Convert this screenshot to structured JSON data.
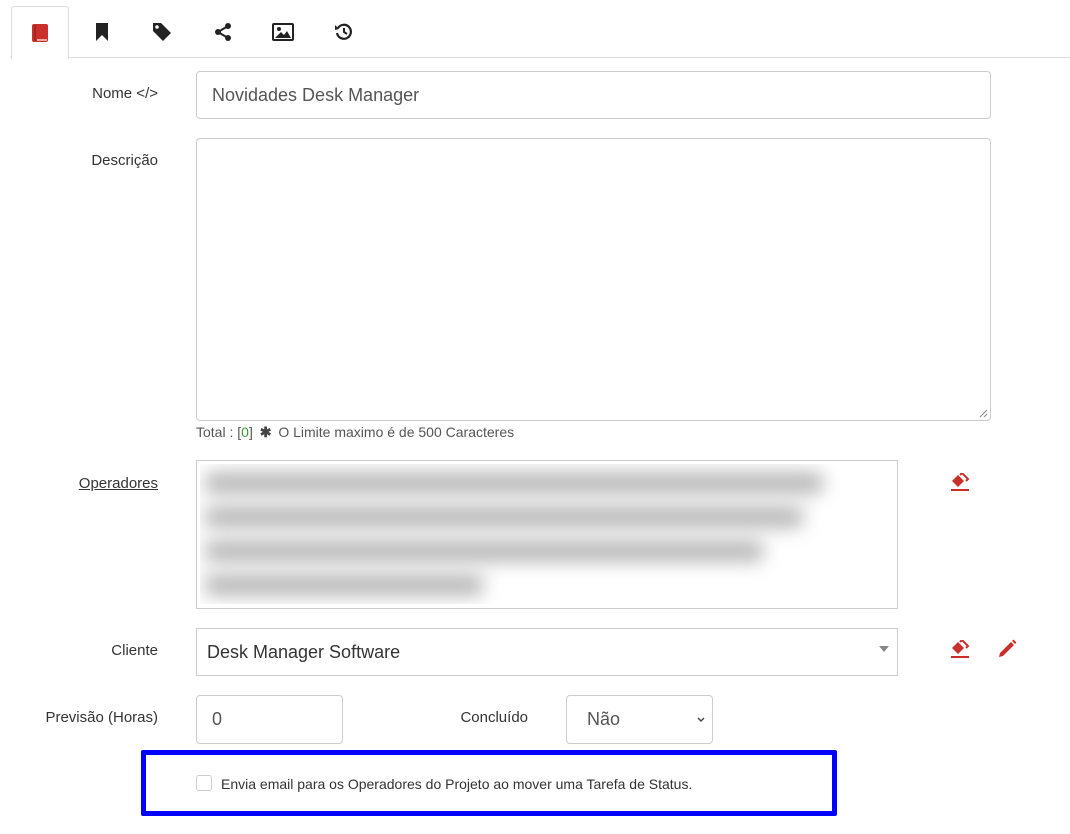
{
  "tabs": [
    {
      "icon": "book-icon",
      "active": true
    },
    {
      "icon": "bookmark-icon",
      "active": false
    },
    {
      "icon": "tag-icon",
      "active": false
    },
    {
      "icon": "share-icon",
      "active": false
    },
    {
      "icon": "image-icon",
      "active": false
    },
    {
      "icon": "history-icon",
      "active": false
    }
  ],
  "form": {
    "nome_label": "Nome </>",
    "nome_value": "Novidades Desk Manager",
    "descricao_label": "Descrição",
    "descricao_value": "",
    "char_counter": {
      "prefix": "Total : [",
      "count": "0",
      "suffix": "]",
      "note": "O Limite maximo é de 500 Caracteres"
    },
    "operadores_label": "Operadores",
    "cliente_label": "Cliente",
    "cliente_value": "Desk Manager Software",
    "previsao_label": "Previsão (Horas)",
    "previsao_value": "0",
    "concluido_label": "Concluído",
    "concluido_value": "Não",
    "email_checkbox_label": "Envia email para os Operadores do Projeto ao mover uma Tarefa de Status.",
    "email_checkbox_checked": false
  },
  "colors": {
    "accent_icon": "#c9302c",
    "counter_green": "#3c9a3c",
    "highlight_border": "#0000ff"
  }
}
